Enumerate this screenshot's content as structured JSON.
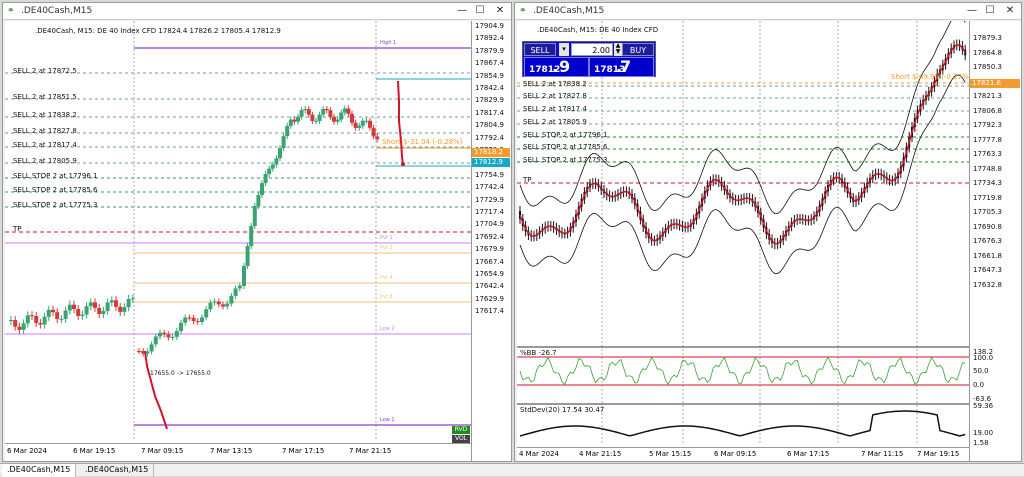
{
  "colors": {
    "bull": "#3aa373",
    "bear": "#d33a3a",
    "purple": "#8f3ec9",
    "cyan": "#18a9c6",
    "orange": "#f39b2f",
    "red": "#d0152b",
    "green": "#1a8e1a"
  },
  "left_window": {
    "title": ".DE40Cash,M15",
    "header": ".DE40Cash, M15:  DE 40 Index CFD  17824.4 17826.2 17805.4 17812.9",
    "price_axis": [
      "17904.9",
      "17892.4",
      "17879.9",
      "17867.4",
      "17854.9",
      "17842.4",
      "17829.9",
      "17817.4",
      "17804.9",
      "17792.4",
      "17779.9",
      "17767.4",
      "17754.9",
      "17742.4",
      "17729.9",
      "17717.4",
      "17704.9",
      "17692.4",
      "17679.9",
      "17667.4",
      "17654.9",
      "17642.4",
      "17629.9",
      "17617.4"
    ],
    "orders": [
      "SELL 2 at 17872.5",
      "SELL 2 at 17851.5",
      "SELL 2 at 17838.2",
      "SELL 2 at 17827.8",
      "SELL 2 at 17817.4",
      "SELL 2 at 17805.9",
      "SELL STOP 2 at 17796.1",
      "SELL STOP 2 at 17785.6",
      "SELL STOP 2 at 17775.3"
    ],
    "tp_label": "TP",
    "pivot_labels": [
      "High 1",
      "Pvt 1",
      "Pvt 3",
      "Pvt 4",
      "Pvt 5",
      "Low 2",
      "Low 1"
    ],
    "profit_label": "Short  $-31.04 (-0.28%)",
    "price_tag_orange": "17818.2",
    "price_tag_blue": "17812.9",
    "annot_small": "17655.0 -> 17655.0",
    "time_axis": [
      "6 Mar 2024",
      "6 Mar 19:15",
      "7 Mar 09:15",
      "7 Mar 13:15",
      "7 Mar 17:15",
      "7 Mar 21:15"
    ],
    "buttons": [
      "RVD",
      "VOL"
    ]
  },
  "right_window": {
    "title": ".DE40Cash,M15",
    "header": ".DE40Cash, M15:  DE 40 Index CFD",
    "trade_panel": {
      "sell_label": "SELL",
      "buy_label": "BUY",
      "volume": "2.00",
      "bid_big": "17812",
      "bid_small": "9",
      "ask_big": "17813",
      "ask_small": "7",
      "bid_sep": ".",
      "ask_sep": "."
    },
    "price_axis": [
      "17879.3",
      "17864.8",
      "17850.3",
      "17835.8",
      "17821.3",
      "17806.8",
      "17792.3",
      "17777.8",
      "17763.3",
      "17748.8",
      "17734.3",
      "17719.8",
      "17705.3",
      "17690.8",
      "17676.3",
      "17661.8",
      "17647.3",
      "17632.8"
    ],
    "orders": [
      "SELL 2 at 17838.2",
      "SELL 2 at 17827.8",
      "SELL 2 at 17817.4",
      "SELL 2 at 17805.9",
      "SELL STOP 2 at 17796.1",
      "SELL STOP 2 at 17785.6",
      "SELL STOP 2 at 17775.3"
    ],
    "tp_label": "TP",
    "profit_label": "Short  $-09.95 (-0.27%)",
    "price_tag": "17821.6",
    "bb_label": "%BB -26.7",
    "bb_axis": [
      "138.2",
      "100.0",
      "50.0",
      "0.0",
      "-63.6"
    ],
    "std_label": "StdDev(20) 17.54 30.47",
    "std_axis": [
      "59.36",
      "19.00",
      "1.58"
    ],
    "time_axis": [
      "4 Mar 2024",
      "4 Mar 21:15",
      "5 Mar 15:15",
      "6 Mar 09:15",
      "6 Mar 17:15",
      "7 Mar 11:15",
      "7 Mar 19:15"
    ]
  },
  "bottom_tabs": [
    ".DE40Cash,M15",
    ".DE40Cash,M15"
  ]
}
